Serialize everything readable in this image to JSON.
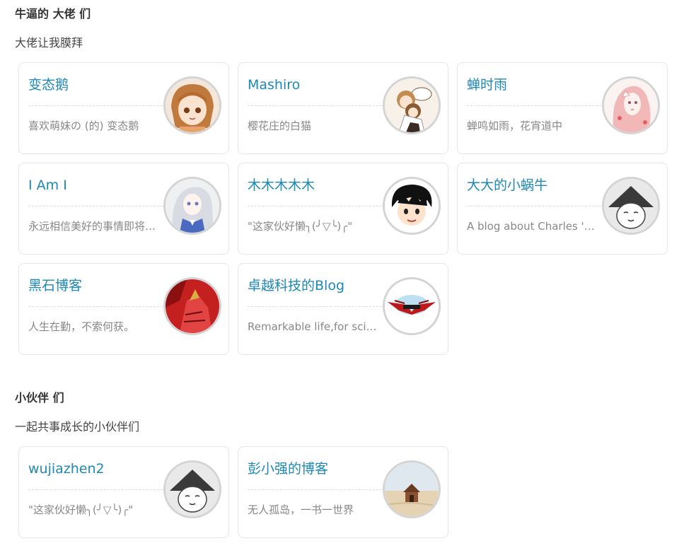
{
  "sections": [
    {
      "title": "牛逼的 大佬 们",
      "description": "大佬让我膜拜",
      "cards": [
        {
          "name": "变态鹅",
          "desc": "喜欢萌妹の (的) 变态鹅",
          "avatar_icon": "anime-girl-brown-hair-avatar"
        },
        {
          "name": "Mashiro",
          "desc": "樱花庄的白猫",
          "avatar_icon": "anime-couple-avatar"
        },
        {
          "name": "蝉时雨",
          "desc": "蝉鸣如雨，花宵道中",
          "avatar_icon": "anime-girl-pink-hair-avatar"
        },
        {
          "name": "I Am I",
          "desc": "永远相信美好的事情即将发生",
          "avatar_icon": "anime-girl-silver-hair-avatar"
        },
        {
          "name": "木木木木木",
          "desc": "\"这家伙好懒╮(╯▽╰)╭\"",
          "avatar_icon": "cartoon-boy-black-hair-avatar"
        },
        {
          "name": "大大的小蜗牛",
          "desc": "A blog about Charles 'escape' life",
          "avatar_icon": "straw-hat-face-avatar"
        },
        {
          "name": "黑石博客",
          "desc": "人生在勤，不索何获。",
          "avatar_icon": "red-armor-warrior-avatar"
        },
        {
          "name": "卓越科技的Blog",
          "desc": "Remarkable life,for science.",
          "avatar_icon": "red-wings-logo-avatar"
        }
      ]
    },
    {
      "title": "小伙伴 们",
      "description": "一起共事成长的小伙伴们",
      "cards": [
        {
          "name": "wujiazhen2",
          "desc": "\"这家伙好懒╮(╯▽╰)╭\"",
          "avatar_icon": "straw-hat-face-avatar"
        },
        {
          "name": "彭小强的博客",
          "desc": "无人孤岛，一书一世界",
          "avatar_icon": "beach-hut-avatar"
        }
      ]
    }
  ],
  "colors": {
    "link": "#1e88b6",
    "desc": "#888888",
    "border": "#e6e6e6"
  }
}
